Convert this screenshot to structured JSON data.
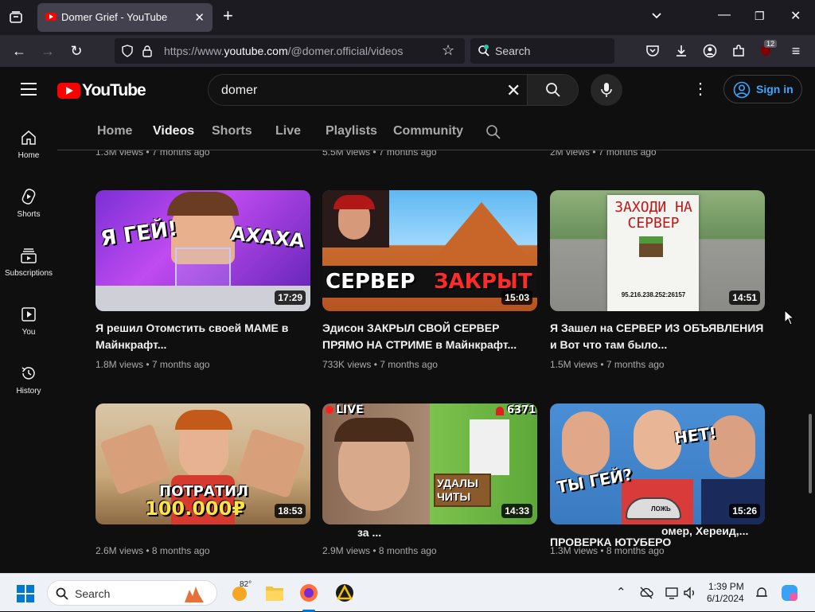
{
  "browser": {
    "tab_title": "Domer Grief - YouTube",
    "url_prefix": "https://www.",
    "url_domain": "youtube.com",
    "url_path": "/@domer.official/videos",
    "search_placeholder": "Search",
    "extensions_badge": "12"
  },
  "yt": {
    "logo_text": "YouTube",
    "search_query": "domer",
    "signin_label": "Sign in",
    "sidebar": [
      {
        "label": "Home",
        "icon": "home-icon"
      },
      {
        "label": "Shorts",
        "icon": "shorts-icon"
      },
      {
        "label": "Subscriptions",
        "icon": "subscriptions-icon"
      },
      {
        "label": "You",
        "icon": "you-icon"
      },
      {
        "label": "History",
        "icon": "history-icon"
      }
    ],
    "channel_tabs": [
      "Home",
      "Videos",
      "Shorts",
      "Live",
      "Playlists",
      "Community"
    ],
    "active_tab": "Videos",
    "prev_row_meta": [
      "1.3M views • 7 months ago",
      "5.5M views • 7 months ago",
      "2M views • 7 months ago"
    ],
    "videos": [
      {
        "title": "Я решил Отомстить своей МАМЕ в Майнкрафт...",
        "duration": "17:29",
        "meta": "1.8M views • 7 months ago",
        "thumb_text_left": "Я ГЕЙ!",
        "thumb_text_right": "АХАХА"
      },
      {
        "title": "Эдисон ЗАКРЫЛ СВОЙ СЕРВЕР ПРЯМО НА СТРИМЕ в Майнкрафт...",
        "duration": "15:03",
        "meta": "733K views • 7 months ago",
        "thumb_text_left": "СЕРВЕР",
        "thumb_text_right": "ЗАКРЫТ"
      },
      {
        "title": "Я Зашел на СЕРВЕР ИЗ ОБЪЯВЛЕНИЯ и Вот что там было...",
        "duration": "14:51",
        "meta": "1.5M views • 7 months ago",
        "thumb_text_left": "ЗАХОДИ НА СЕРВЕР",
        "thumb_text_right": "95.216.238.252:26157"
      },
      {
        "title": "",
        "duration": "18:53",
        "meta": "2.6M views • 8 months ago",
        "thumb_text_left": "ПОТРАТИЛ",
        "thumb_text_right": "100.000₽"
      },
      {
        "title": "за ...",
        "duration": "14:33",
        "meta": "2.9M views • 8 months ago",
        "thumb_text_left": "LIVE",
        "thumb_text_right": "6371",
        "thumb_text_extra": "УДАЛЫ ЧИТЫ"
      },
      {
        "title": "ПРОВЕРКА ЮТУБЕРО",
        "title_overlay": "омер, Хереид,...",
        "duration": "15:26",
        "meta": "1.3M views • 8 months ago",
        "thumb_text_left": "ТЫ ГЕЙ?",
        "thumb_text_right": "НЕТ!",
        "thumb_text_extra": "ЛОЖЬ"
      }
    ]
  },
  "taskbar": {
    "search_label": "Search",
    "temperature": "82°",
    "time": "1:39 PM",
    "date": "6/1/2024"
  }
}
